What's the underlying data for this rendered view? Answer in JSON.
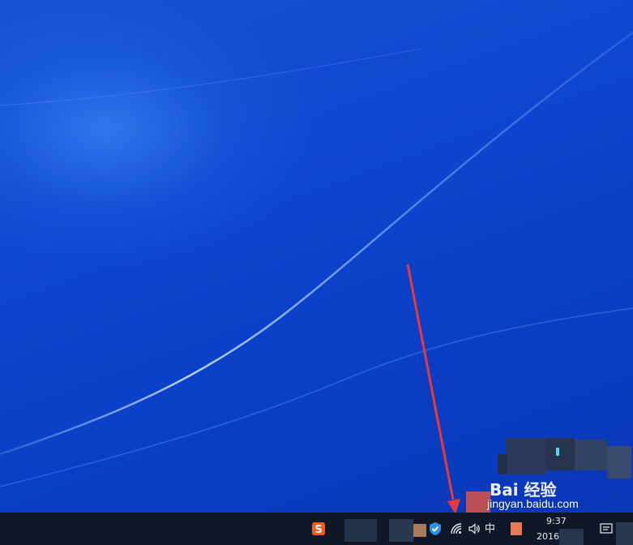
{
  "taskbar": {
    "ime_mode": "中",
    "clock": {
      "time": "9:37",
      "date": "2016"
    },
    "tray_icons": [
      "sogou-input-icon",
      "security-shield-icon",
      "wifi-icon",
      "volume-icon",
      "ime-icon",
      "action-center-icon"
    ]
  },
  "watermark": {
    "text": "Bai 经验",
    "url": "jingyan.baidu.com"
  },
  "colors": {
    "desktop": "#0d46cf",
    "taskbar": "#101827",
    "arrow": "#e8393a",
    "sogou": "#f25c1b"
  }
}
